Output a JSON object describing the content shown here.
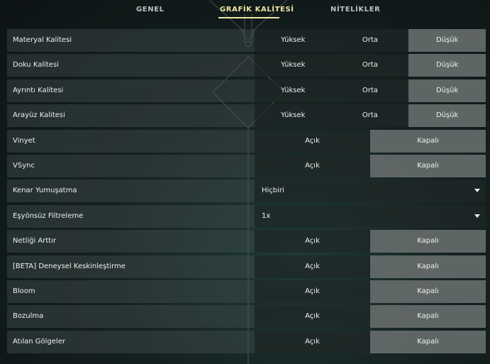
{
  "tabs": [
    {
      "label": "GENEL",
      "active": false
    },
    {
      "label": "GRAFİK KALİTESİ",
      "active": true
    },
    {
      "label": "NİTELİKLER",
      "active": false
    }
  ],
  "rows": [
    {
      "label": "Materyal Kalitesi",
      "options": [
        "Yüksek",
        "Orta",
        "Düşük"
      ],
      "selected": "Düşük"
    },
    {
      "label": "Doku Kalitesi",
      "options": [
        "Yüksek",
        "Orta",
        "Düşük"
      ],
      "selected": "Düşük"
    },
    {
      "label": "Ayrıntı Kalitesi",
      "options": [
        "Yüksek",
        "Orta",
        "Düşük"
      ],
      "selected": "Düşük"
    },
    {
      "label": "Arayüz Kalitesi",
      "options": [
        "Yüksek",
        "Orta",
        "Düşük"
      ],
      "selected": "Düşük"
    },
    {
      "label": "Vinyet",
      "options": [
        "Açık",
        "Kapalı"
      ],
      "selected": "Kapalı"
    },
    {
      "label": "VSync",
      "options": [
        "Açık",
        "Kapalı"
      ],
      "selected": "Kapalı"
    },
    {
      "label": "Kenar Yumuşatma",
      "dropdown": "Hiçbiri"
    },
    {
      "label": "Eşyönsüz Filtreleme",
      "dropdown": "1x"
    },
    {
      "label": "Netliği Arttır",
      "options": [
        "Açık",
        "Kapalı"
      ],
      "selected": "Kapalı"
    },
    {
      "label": "[BETA] Deneysel Keskinleştirme",
      "options": [
        "Açık",
        "Kapalı"
      ],
      "selected": "Kapalı"
    },
    {
      "label": "Bloom",
      "options": [
        "Açık",
        "Kapalı"
      ],
      "selected": "Kapalı"
    },
    {
      "label": "Bozulma",
      "options": [
        "Açık",
        "Kapalı"
      ],
      "selected": "Kapalı"
    },
    {
      "label": "Atılan Gölgeler",
      "options": [
        "Açık",
        "Kapalı"
      ],
      "selected": "Kapalı"
    }
  ],
  "colors": {
    "accent": "#efe6a6",
    "selected_bg": "#7a807e"
  }
}
